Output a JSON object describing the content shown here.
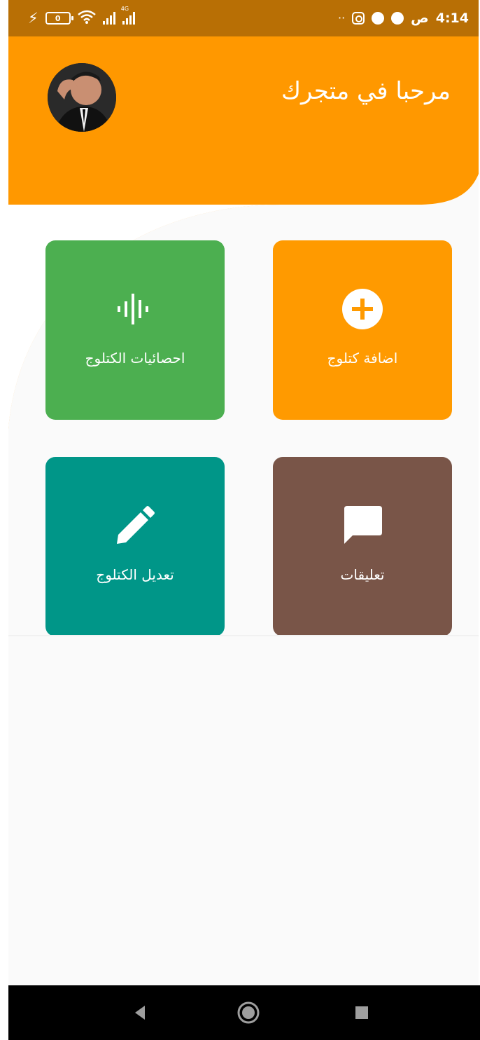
{
  "status_bar": {
    "time": "4:14",
    "time_suffix": "ص",
    "battery_level": "0",
    "network_label": "4G",
    "more_dots": "··"
  },
  "header": {
    "title": "مرحبا في متجرك",
    "accent_color": "#ff9800"
  },
  "tiles": [
    {
      "label": "اضافة كتلوج",
      "icon": "add-circle-icon",
      "color": "#ff9a00"
    },
    {
      "label": "احصائيات الكتلوج",
      "icon": "equalizer-icon",
      "color": "#4caf50"
    },
    {
      "label": "تعليقات",
      "icon": "chat-icon",
      "color": "#795548"
    },
    {
      "label": "تعديل الكتلوج",
      "icon": "pencil-icon",
      "color": "#009688"
    }
  ],
  "nav_bar": {
    "buttons": [
      "back-icon",
      "home-icon",
      "recents-icon"
    ]
  }
}
